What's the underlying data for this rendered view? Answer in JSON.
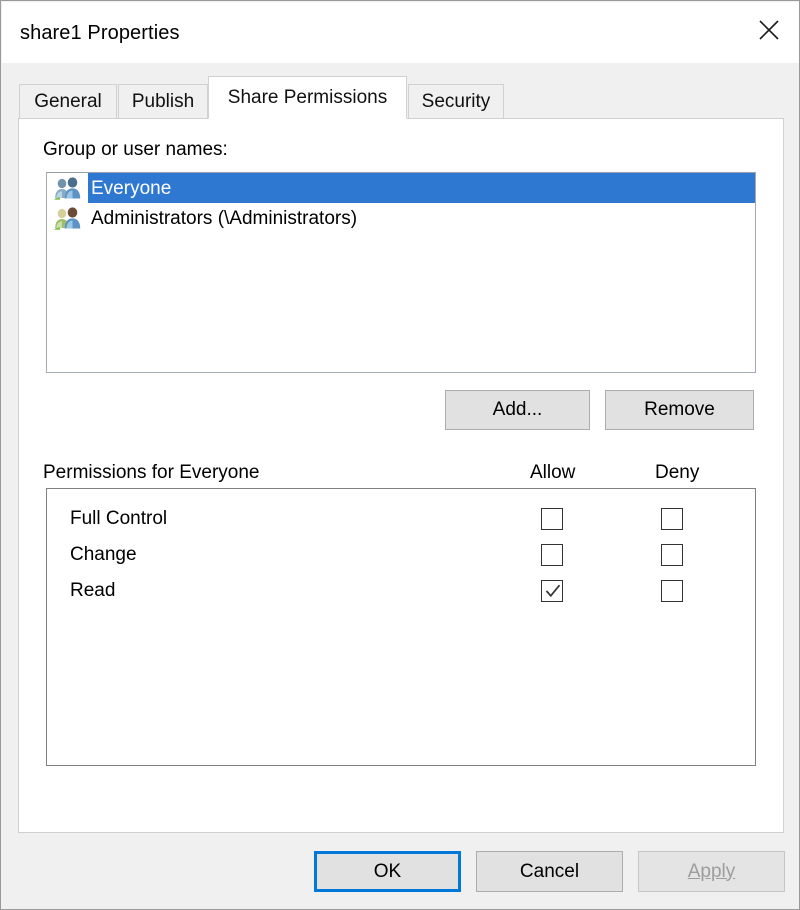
{
  "window": {
    "title": "share1 Properties",
    "close_icon": "close-icon"
  },
  "tabs": [
    {
      "label": "General",
      "active": false
    },
    {
      "label": "Publish",
      "active": false
    },
    {
      "label": "Share Permissions",
      "active": true
    },
    {
      "label": "Security",
      "active": false
    }
  ],
  "group_section": {
    "label": "Group or user names:",
    "items": [
      {
        "name": "Everyone",
        "selected": true,
        "icon": "group-users-icon"
      },
      {
        "name": "Administrators (\\Administrators)",
        "selected": false,
        "icon": "group-users-icon"
      }
    ],
    "add_button": "Add...",
    "remove_button": "Remove"
  },
  "permissions_section": {
    "label": "Permissions for Everyone",
    "columns": [
      "Allow",
      "Deny"
    ],
    "rows": [
      {
        "name": "Full Control",
        "allow": false,
        "deny": false
      },
      {
        "name": "Change",
        "allow": false,
        "deny": false
      },
      {
        "name": "Read",
        "allow": true,
        "deny": false
      }
    ]
  },
  "footer": {
    "ok": "OK",
    "cancel": "Cancel",
    "apply": "Apply",
    "apply_enabled": false
  },
  "colors": {
    "selection_blue": "#2f78d2",
    "focus_blue": "#0078d7",
    "dialog_bg": "#f0f0f0",
    "panel_bg": "#ffffff"
  }
}
